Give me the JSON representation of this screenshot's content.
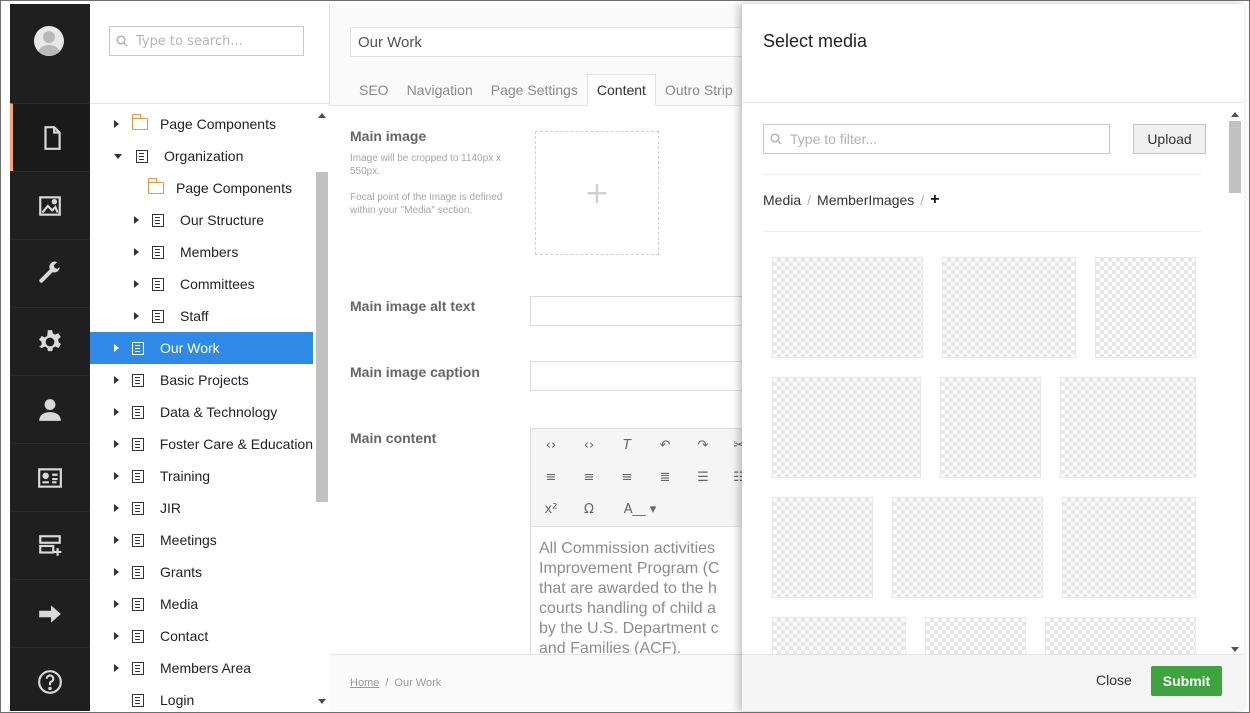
{
  "tree": {
    "search_placeholder": "Type to search...",
    "nodes": [
      {
        "label": "Page Components"
      },
      {
        "label": "Organization"
      },
      {
        "label": "Page Components"
      },
      {
        "label": "Our Structure"
      },
      {
        "label": "Members"
      },
      {
        "label": "Committees"
      },
      {
        "label": "Staff"
      },
      {
        "label": "Our Work"
      },
      {
        "label": "Basic Projects"
      },
      {
        "label": "Data & Technology"
      },
      {
        "label": "Foster Care & Education"
      },
      {
        "label": "Training"
      },
      {
        "label": "JIR"
      },
      {
        "label": "Meetings"
      },
      {
        "label": "Grants"
      },
      {
        "label": "Media"
      },
      {
        "label": "Contact"
      },
      {
        "label": "Members Area"
      },
      {
        "label": "Login"
      }
    ]
  },
  "editor": {
    "page_name": "Our Work",
    "tabs": [
      "SEO",
      "Navigation",
      "Page Settings",
      "Content",
      "Outro Strip"
    ],
    "active_tab": "Content",
    "main_image_label": "Main image",
    "main_image_desc1": "Image will be cropped to 1140px x 550px.",
    "main_image_desc2": "Focal point of the image is defined within your \"Media\" section.",
    "alt_label": "Main image alt text",
    "caption_label": "Main image caption",
    "content_label": "Main content",
    "content_line1": "All Commission activities",
    "content_line2a": "Improvement Program (",
    "content_line2b": "C",
    "content_line3": "that are awarded to the h",
    "content_line4": "courts handling of child a",
    "content_line5": "by the U.S. Department c",
    "content_line6": "and Families (ACF).",
    "breadcrumb_home": "Home",
    "breadcrumb_sep": "/",
    "breadcrumb_current": "Our Work"
  },
  "dialog": {
    "title": "Select media",
    "filter_placeholder": "Type to filter...",
    "upload_label": "Upload",
    "breadcrumb": [
      "Media",
      "MemberImages"
    ],
    "breadcrumb_sep": "/",
    "breadcrumb_add": "+",
    "close_label": "Close",
    "submit_label": "Submit"
  },
  "colors": {
    "selected": "#2e8ae6",
    "submit": "#3fa43f",
    "active_section": "#f5a470",
    "folder": "#e8924e"
  }
}
